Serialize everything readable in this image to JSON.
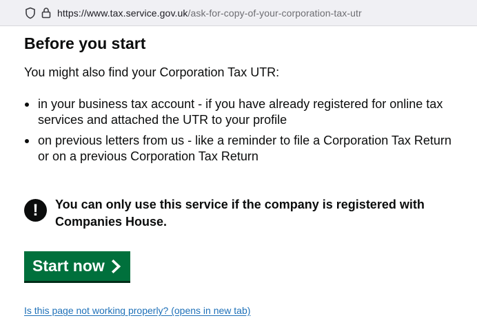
{
  "browser": {
    "url_host": "https://www.tax.service.gov.uk",
    "url_path": "/ask-for-copy-of-your-corporation-tax-utr"
  },
  "page": {
    "heading": "Before you start",
    "intro": "You might also find your Corporation Tax UTR:",
    "list_items": [
      "in your business tax account - if you have already registered for online tax services and attached the UTR to your profile",
      "on previous letters from us - like a reminder to file a Corporation Tax Return or on a previous Corporation Tax Return"
    ],
    "warning": {
      "icon_text": "!",
      "text": "You can only use this service if the company is registered with Companies House."
    },
    "start_button_label": "Start now",
    "help_link": "Is this page not working properly? (opens in new tab)"
  },
  "colors": {
    "button_green": "#00703c",
    "link_blue": "#1d70b8",
    "text": "#0b0c0c"
  },
  "icons": [
    "shield-icon",
    "lock-icon",
    "warning-icon",
    "chevron-right-icon"
  ]
}
